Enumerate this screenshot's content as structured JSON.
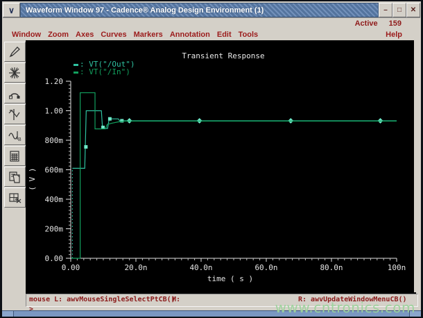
{
  "window": {
    "title": "Waveform Window 97 - Cadence® Analog Design Environment (1)",
    "menu_button_glyph": "∨",
    "controls": {
      "minimize": "–",
      "maximize": "□",
      "close": "✕"
    },
    "active_label": "Active",
    "active_count": "159"
  },
  "menubar": {
    "items": [
      {
        "label": "Window"
      },
      {
        "label": "Zoom"
      },
      {
        "label": "Axes"
      },
      {
        "label": "Curves"
      },
      {
        "label": "Markers"
      },
      {
        "label": "Annotation"
      },
      {
        "label": "Edit"
      },
      {
        "label": "Tools"
      }
    ],
    "help_label": "Help"
  },
  "toolbar": {
    "icons": [
      "pen-icon",
      "zoom-star-icon",
      "arc-probe-icon",
      "marker-waveform-icon",
      "sine-b-icon",
      "calculator-icon",
      "copy-window-icon",
      "cut-window-icon"
    ]
  },
  "statusbar": {
    "left": "mouse L: awvMouseSingleSelectPtCB()",
    "middle": "M:",
    "right": "R: awvUpdateWindowMenuCB()",
    "prompt": ">"
  },
  "watermark": "www.cntronics.com",
  "colors": {
    "out_trace": "#2fc1a0",
    "in_trace": "#12a05e",
    "marker": "#6fe9c8",
    "axis": "#e4e4e4",
    "plot_bg": "#000000",
    "titlebar_stripe": "#54749e",
    "menu_text": "#9b1b1b",
    "frame_blue": "#7a97c1"
  },
  "chart_data": {
    "type": "line",
    "title": "Transient Response",
    "xlabel": "time ( s )",
    "ylabel": "( V )",
    "xlim_ns": [
      0,
      100
    ],
    "ylim_v": [
      0,
      1.2
    ],
    "grid": false,
    "legend_position": "top-left",
    "xticks": [
      {
        "v": 0,
        "label": "0.00"
      },
      {
        "v": 20,
        "label": "20.0n"
      },
      {
        "v": 40,
        "label": "40.0n"
      },
      {
        "v": 60,
        "label": "60.0n"
      },
      {
        "v": 80,
        "label": "80.0n"
      },
      {
        "v": 100,
        "label": "100n"
      }
    ],
    "yticks": [
      {
        "v": 0.0,
        "label": "0.00"
      },
      {
        "v": 0.2,
        "label": "200m"
      },
      {
        "v": 0.4,
        "label": "400m"
      },
      {
        "v": 0.6,
        "label": "600m"
      },
      {
        "v": 0.8,
        "label": "800m"
      },
      {
        "v": 1.0,
        "label": "1.00"
      },
      {
        "v": 1.2,
        "label": "1.20"
      }
    ],
    "legend": [
      {
        "display": ": VT(\"/Out\")",
        "color": "#2fc1a0"
      },
      {
        "display": ": VT(\"/In\")",
        "color": "#12a05e"
      }
    ],
    "series": [
      {
        "name": "VT(\"/Out\")",
        "color": "#2fc1a0",
        "dash_edge": [
          [
            0.5,
            0.0
          ],
          [
            0.5,
            0.61
          ]
        ],
        "points": [
          [
            0.5,
            0.61
          ],
          [
            4.3,
            0.61
          ],
          [
            4.75,
            1.0
          ],
          [
            9.4,
            1.0
          ],
          [
            9.7,
            0.9
          ],
          [
            10.1,
            0.88
          ],
          [
            11.3,
            0.88
          ],
          [
            11.8,
            0.945
          ],
          [
            14.6,
            0.945
          ],
          [
            15.0,
            0.932
          ],
          [
            100,
            0.932
          ]
        ],
        "square_markers": [
          [
            4.65,
            0.755
          ],
          [
            9.9,
            0.887
          ],
          [
            12.0,
            0.945
          ],
          [
            15.7,
            0.932
          ]
        ],
        "diamond_markers": [
          [
            18,
            0.932
          ],
          [
            39.5,
            0.932
          ],
          [
            67.5,
            0.932
          ],
          [
            95,
            0.932
          ]
        ]
      },
      {
        "name": "VT(\"/In\")",
        "color": "#12a05e",
        "points": [
          [
            0.2,
            0.0
          ],
          [
            2.9,
            0.0
          ],
          [
            2.9,
            1.122
          ],
          [
            7.45,
            1.122
          ],
          [
            7.45,
            0.877
          ],
          [
            10.6,
            0.877
          ],
          [
            11.2,
            0.907
          ],
          [
            12.5,
            0.915
          ],
          [
            14.5,
            0.924
          ],
          [
            16.5,
            0.93
          ],
          [
            100,
            0.93
          ]
        ]
      }
    ]
  }
}
